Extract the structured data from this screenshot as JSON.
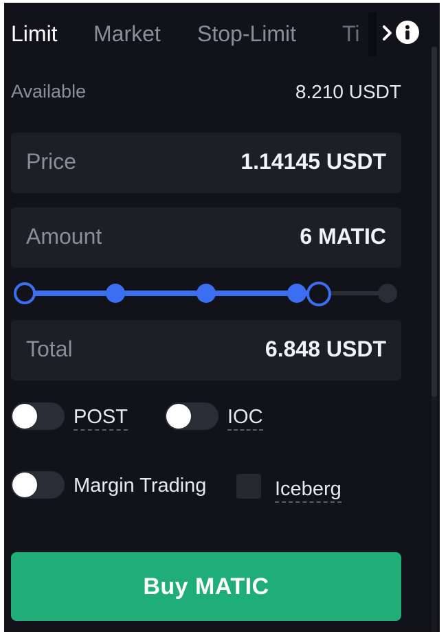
{
  "tabs": [
    {
      "label": "Limit",
      "active": true
    },
    {
      "label": "Market",
      "active": false
    },
    {
      "label": "Stop-Limit",
      "active": false
    },
    {
      "label": "Ti",
      "active": false
    }
  ],
  "tab_icons": {
    "more": "chevron-right-icon",
    "info": "info-icon"
  },
  "available": {
    "label": "Available",
    "value": "8.210 USDT"
  },
  "price": {
    "label": "Price",
    "value": "1.14145 USDT"
  },
  "amount": {
    "label": "Amount",
    "value": "6 MATIC"
  },
  "amount_slider": {
    "stops": 5,
    "value_fraction": 0.81
  },
  "total": {
    "label": "Total",
    "value": "6.848 USDT"
  },
  "options": {
    "post": {
      "label": "POST",
      "on": false
    },
    "ioc": {
      "label": "IOC",
      "on": false
    },
    "margin": {
      "label": "Margin Trading",
      "on": false
    },
    "iceberg": {
      "label": "Iceberg",
      "checked": false
    }
  },
  "buy_button": {
    "label": "Buy MATIC"
  },
  "colors": {
    "background": "#12131a",
    "field": "#1d1f27",
    "accent_blue": "#3b6ef0",
    "buy_green": "#1fae78",
    "muted_text": "#8a8e99"
  }
}
